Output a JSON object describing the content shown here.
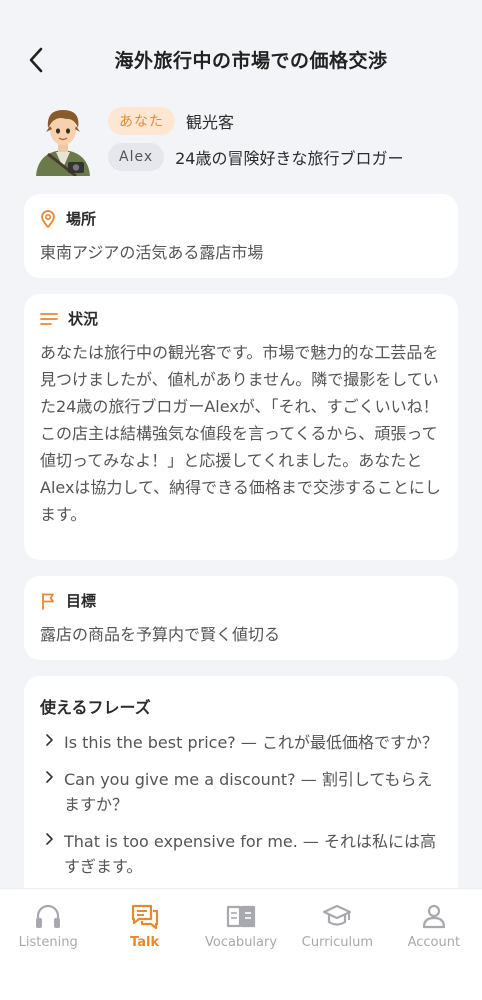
{
  "header": {
    "title": "海外旅行中の市場での価格交渉"
  },
  "roles": [
    {
      "tag": "あなた",
      "desc": "観光客"
    },
    {
      "tag": "Alex",
      "desc": "24歳の冒険好きな旅行ブロガー"
    }
  ],
  "location": {
    "title": "場所",
    "body": "東南アジアの活気ある露店市場"
  },
  "situation": {
    "title": "状況",
    "body": "あなたは旅行中の観光客です。市場で魅力的な工芸品を見つけましたが、値札がありません。隣で撮影をしていた24歳の旅行ブロガーAlexが、「それ、すごくいいね！この店主は結構強気な値段を言ってくるから、頑張って値切ってみなよ！」と応援してくれました。あなたとAlexは協力して、納得できる価格まで交渉することにします。"
  },
  "goal": {
    "title": "目標",
    "body": "露店の商品を予算内で賢く値切る"
  },
  "phrases": {
    "title": "使えるフレーズ",
    "items": [
      "Is this the best price? — これが最低価格ですか？",
      "Can you give me a discount? — 割引してもらえますか？",
      "That is too expensive for me. — それは私には高すぎます。"
    ]
  },
  "tabbar": {
    "items": [
      {
        "label": "Listening",
        "icon": "headphones-icon"
      },
      {
        "label": "Talk",
        "icon": "chat-icon"
      },
      {
        "label": "Vocabulary",
        "icon": "book-icon"
      },
      {
        "label": "Curriculum",
        "icon": "graduation-cap-icon"
      },
      {
        "label": "Account",
        "icon": "person-icon"
      }
    ],
    "active_index": 1
  },
  "colors": {
    "accent": "#e8882f",
    "background": "#f3f4f8",
    "card": "#ffffff",
    "inactive": "#a8a8b0"
  }
}
